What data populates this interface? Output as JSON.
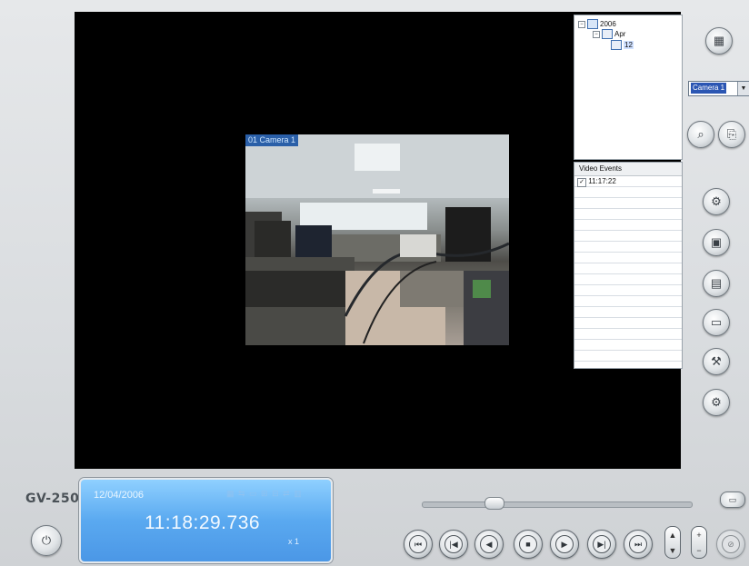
{
  "app": {
    "brand": "GV-250"
  },
  "camera_feed": {
    "label": "01 Camera 1"
  },
  "tree": {
    "year": "2006",
    "month": "Apr",
    "day": "12",
    "expander_minus": "−"
  },
  "video_events": {
    "header": "Video Events",
    "items": [
      {
        "checked": true,
        "time": "11:17:22"
      }
    ]
  },
  "camera_select": {
    "selected": "Camera 1",
    "arrow": "▼"
  },
  "lcd": {
    "date": "12/04/2006",
    "time": "11:18:29.736",
    "speed": "x 1",
    "status_icons": "▦ ⇆ ▭ ⊞ ⊟ ⇄ ▥"
  },
  "playback": {
    "progress": 0.25,
    "buttons": [
      {
        "name": "first-frame",
        "glyph": "⏮"
      },
      {
        "name": "previous-frame",
        "glyph": "|◀"
      },
      {
        "name": "rewind",
        "glyph": "◀"
      },
      {
        "name": "stop",
        "glyph": "■"
      },
      {
        "name": "play",
        "glyph": "▶"
      },
      {
        "name": "next-frame",
        "glyph": "▶|"
      },
      {
        "name": "last-frame",
        "glyph": "⏭"
      }
    ],
    "speed_up": "▲",
    "speed_down": "▼",
    "zoom_in": "+",
    "zoom_out": "−"
  },
  "icons": {
    "power": "⏻",
    "grid": "▦",
    "search": "⌕",
    "copy": "⎘",
    "settings": "⚙",
    "save_avi": "▣",
    "save_image": "▤",
    "print": "▭",
    "tools": "⚒",
    "config": "⚙",
    "fullscreen": "▭",
    "disabled": "⊘"
  }
}
